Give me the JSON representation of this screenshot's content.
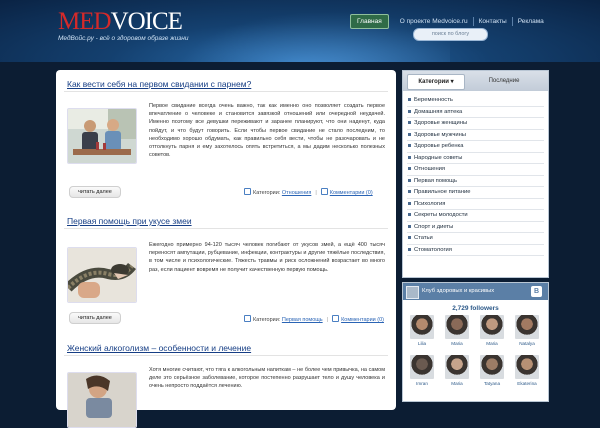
{
  "header": {
    "logo_part1": "MED",
    "logo_part2": "VOICE",
    "tagline": "МедВойс.ру - всё о здоровом образе жизни",
    "nav": [
      "Главная",
      "О проекте Medvoice.ru",
      "Контакты",
      "Реклама"
    ],
    "search_placeholder": "поиск по блогу"
  },
  "posts": [
    {
      "title": "Как вести себя на первом свидании с парнем?",
      "text": "Первое свидание всегда очень важно, так как именно оно позволяет создать первое впечатление о человеке и становится завязкой отношений или очередной неудачей. Именно поэтому все девушки переживают и заранее планируют, что они наденут, куда пойдут, и что будут говорить. Если чтобы первое свидание не стало последним, то необходимо хорошо обдумать, как правильно себя вести, чтобы не разочаровать и не оттолкнуть парня и ему захотелось опять встретиться, а мы дадим несколько полезных советов.",
      "read_more": "читать далее",
      "category_label": "Категории:",
      "category": "Отношения",
      "comments": "Комментарии (0)"
    },
    {
      "title": "Первая помощь при укусе змеи",
      "text": "Ежегодно примерно 94-120 тысяч человек погибают от укусов змей, а ещё 400 тысяч переносят ампутации, рубцевание, инфекции, контрактуры и другие тяжёлые последствия, в том числе и психологические. Тяжесть травмы и риск осложнений возрастает во много раз, если пациент вовремя не получит качественную первую помощь.",
      "read_more": "читать далее",
      "category_label": "Категории:",
      "category": "Первая помощь",
      "comments": "Комментарии (0)"
    },
    {
      "title": "Женский алкоголизм – особенности и лечение",
      "text": "Хотя многие считают, что тяга к алкогольным напиткам – не более чем привычка, на самом деле это серьёзное заболевание, которое постепенно разрушает тело и душу человека и очень непросто поддаётся лечению."
    }
  ],
  "sidebar": {
    "tabs": [
      "Категории",
      "Последние"
    ],
    "categories": [
      "Беременность",
      "Домашняя аптека",
      "Здоровье женщины",
      "Здоровье мужчины",
      "Здоровье ребенка",
      "Народные советы",
      "Отношения",
      "Первая помощь",
      "Правильное питание",
      "Психология",
      "Секреты молодости",
      "Спорт и диеты",
      "Статьи",
      "Стоматология"
    ]
  },
  "vk": {
    "name": "Клуб здоровых и красивых",
    "logo": "B",
    "followers": "2,729 followers",
    "members": [
      "Lilia",
      "Maria",
      "Maria",
      "Natalya",
      "Imran",
      "Maria",
      "Tatyana",
      "Ekaterina"
    ]
  },
  "colors": {
    "header_bg": "#14406f",
    "link": "#163e85",
    "logo_red": "#d42a2a",
    "active_nav": "#2f6b47"
  }
}
